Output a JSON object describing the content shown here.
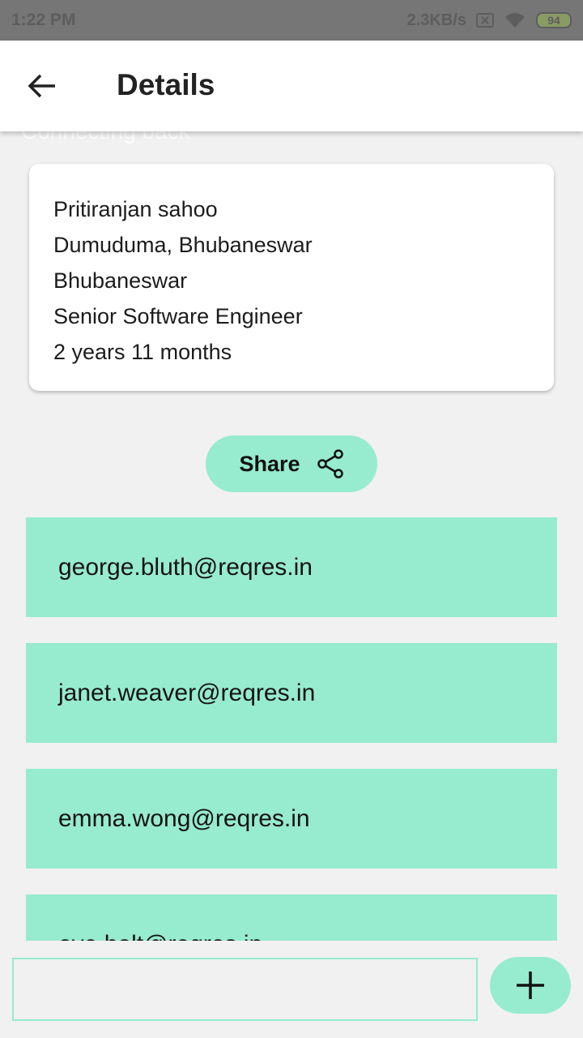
{
  "status_bar": {
    "time": "1:22 PM",
    "network_speed": "2.3KB/s",
    "battery_level": "94",
    "icons": [
      "no-sim-icon",
      "wifi-icon",
      "battery-icon"
    ]
  },
  "app_bar": {
    "title": "Details",
    "back_icon": "arrow-left-icon"
  },
  "overlay_text": "Connecting back",
  "details": {
    "name": "Pritiranjan sahoo",
    "address": "Dumuduma, Bhubaneswar",
    "city": "Bhubaneswar",
    "designation": "Senior Software Engineer",
    "experience": "2 years 11 months"
  },
  "share_button": {
    "label": "Share",
    "icon": "share-icon"
  },
  "emails": [
    "george.bluth@reqres.in",
    "janet.weaver@reqres.in",
    "emma.wong@reqres.in",
    "eve.holt@reqres.in"
  ],
  "bottom_bar": {
    "input_value": "",
    "add_icon": "plus-icon"
  },
  "colors": {
    "accent": "#97ebcf",
    "status_bar": "#767676",
    "background": "#f1f1f1",
    "card": "#ffffff"
  }
}
